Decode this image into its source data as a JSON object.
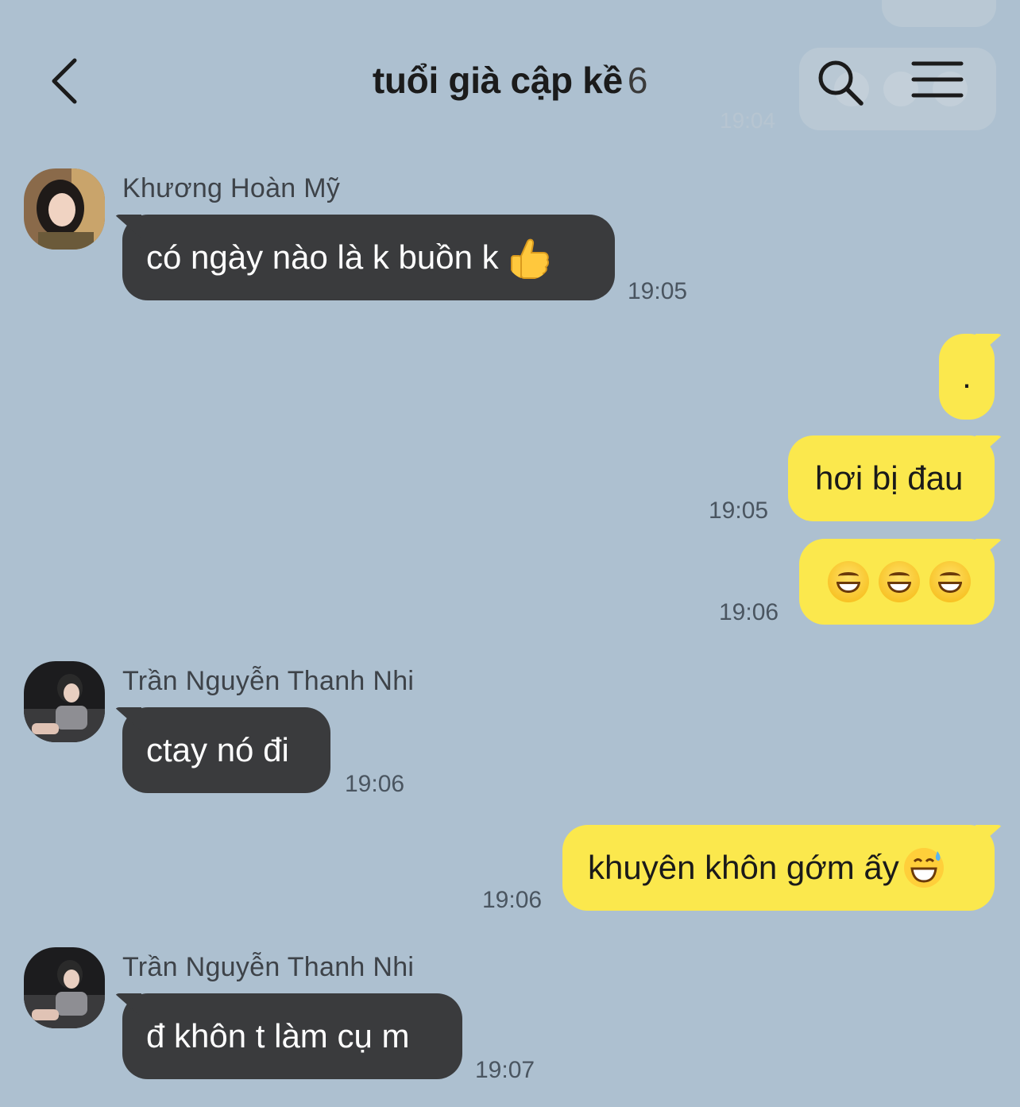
{
  "header": {
    "title": "tuổi già cập kề",
    "member_count": "6"
  },
  "ghost": {
    "time": "19:04"
  },
  "messages": [
    {
      "sender": "Khương Hoàn Mỹ",
      "text": "có ngày nào là k buồn k",
      "emoji": "thumbs-up",
      "time": "19:05"
    },
    {
      "text": ".",
      "time": ""
    },
    {
      "text": "hơi bị đau",
      "time": "19:05"
    },
    {
      "text": "",
      "emoji": "grinning-face x3",
      "time": "19:06"
    },
    {
      "sender": "Trần Nguyễn Thanh Nhi",
      "text": "ctay nó đi",
      "time": "19:06"
    },
    {
      "text": "khuyên khôn gớm ấy",
      "emoji": "grinning-face-with-sweat",
      "time": "19:06"
    },
    {
      "sender": "Trần Nguyễn Thanh Nhi",
      "text": "đ khôn t làm cụ m",
      "time": "19:07"
    }
  ],
  "colors": {
    "background": "#adc0d0",
    "incoming_bubble": "#3a3b3d",
    "outgoing_bubble": "#fbe84d"
  }
}
